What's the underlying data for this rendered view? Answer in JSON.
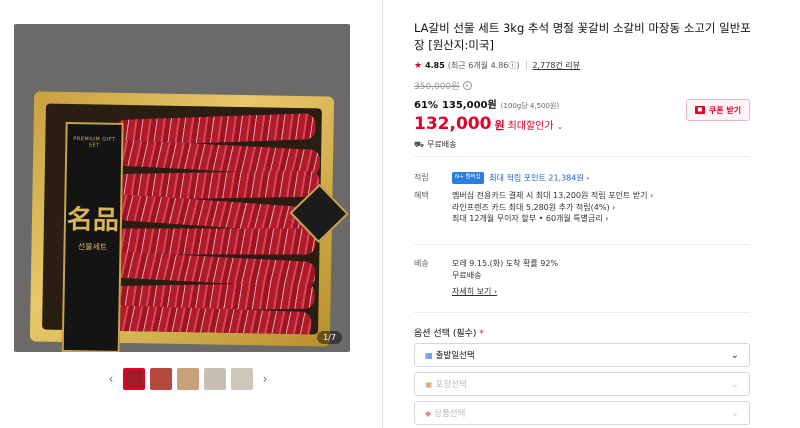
{
  "gallery": {
    "counter": "1/7",
    "label_han": "名品",
    "label_sub": "선물세트",
    "label_eng": "PREMIUM GIFT SET",
    "prev_arrow": "‹",
    "next_arrow": "›"
  },
  "product": {
    "title": "LA갈비 선물 세트 3kg 추석 명절 꽃갈비 소갈비 마장동 소고기 일반포장 [원산지:미국]",
    "rating": "4.85",
    "rating_recent": "(최근 6개월 4.86ⓘ)",
    "review_count": "2,778건 리뷰",
    "original_price": "350,000원",
    "discount_pct": "61%",
    "sale_price": "135,000원",
    "unit_price": "(100g당 4,500원)",
    "best_price": "132,000",
    "best_won": "원",
    "best_label": "최대할인가",
    "shipping": "무료배송"
  },
  "coupon": {
    "label": "쿠폰 받기"
  },
  "benefits": {
    "points_label": "적립",
    "points_badge": "N+ 멤버십",
    "points_text": "최대 적립 포인트 21,384원 ›",
    "benefit_label": "혜택",
    "benefit_lines": [
      "멤버십 전용카드 결제 시 최대 13,200원 적립 포인트 받기 ›",
      "라인프렌즈 카드 최대 5,280원 추가 적립(4%) ›",
      "최대 12개월 무이자 할부 • 60개월 특별금리 ›"
    ]
  },
  "delivery": {
    "label": "배송",
    "line1": "모레 9.15.(화) 도착 확률 92%",
    "line2": "무료배송",
    "detail_link": "자세히 보기 ›"
  },
  "options": {
    "heading": "옵션 선택 (필수)",
    "required_mark": "*",
    "selects": [
      {
        "label": "출발일선택",
        "disabled": false
      },
      {
        "label": "포장선택",
        "disabled": true
      },
      {
        "label": "상품선택",
        "disabled": true
      }
    ]
  },
  "colors": {
    "accent": "#e4002b",
    "points": "#1a5fc0"
  }
}
